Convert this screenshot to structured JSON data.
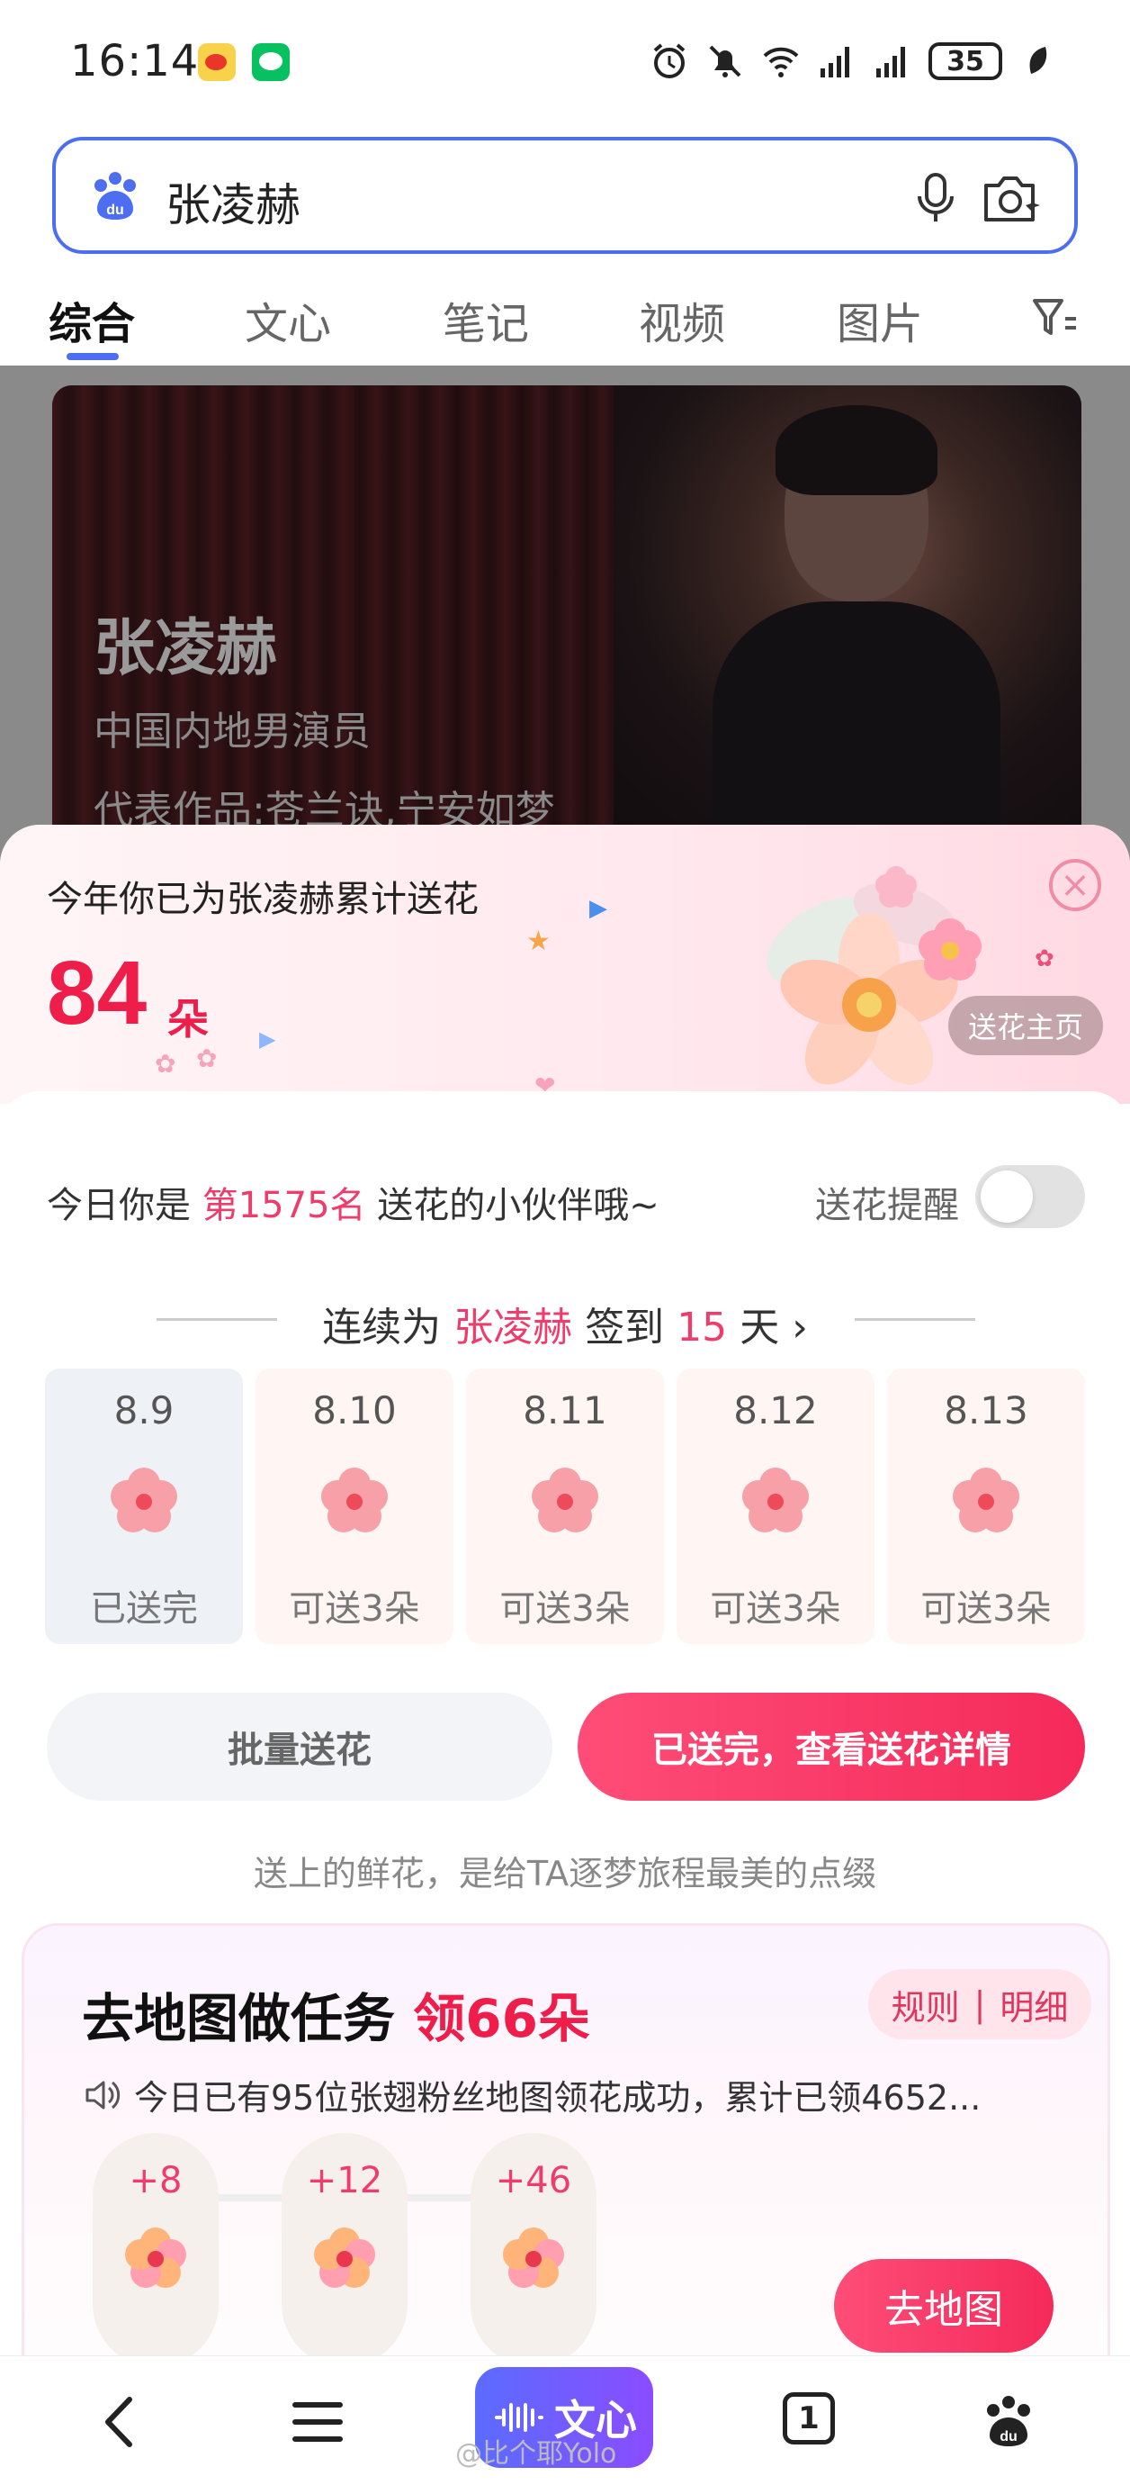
{
  "status_bar": {
    "time": "16:14",
    "battery": "35",
    "icons": [
      "weibo-icon",
      "wechat-icon",
      "alarm-icon",
      "mute-icon",
      "wifi-icon",
      "signal-icon",
      "signal-icon",
      "battery-icon",
      "leaf-icon"
    ]
  },
  "search": {
    "query": "张凌赫",
    "icons": [
      "baidu-logo",
      "microphone-icon",
      "camera-search-icon"
    ]
  },
  "tabs": [
    {
      "label": "综合",
      "active": true
    },
    {
      "label": "文心",
      "active": false
    },
    {
      "label": "笔记",
      "active": false
    },
    {
      "label": "视频",
      "active": false
    },
    {
      "label": "图片",
      "active": false
    }
  ],
  "hero": {
    "name": "张凌赫",
    "subtitle": "中国内地男演员",
    "works": "代表作品:苍兰诀,宁安如梦"
  },
  "gift_panel": {
    "title": "今年你已为张凌赫累计送花",
    "count": "84",
    "unit": "朵",
    "home_button": "送花主页",
    "rank_prefix": "今日你是",
    "rank_value": "第1575名",
    "rank_suffix": "送花的小伙伴哦~",
    "remind_label": "送花提醒",
    "remind_on": false,
    "streak_prefix": "连续为",
    "streak_name": "张凌赫",
    "streak_mid": "签到",
    "streak_days": "15",
    "streak_unit": "天",
    "days": [
      {
        "date": "8.9",
        "status": "已送完",
        "done": true
      },
      {
        "date": "8.10",
        "status": "可送3朵",
        "done": false
      },
      {
        "date": "8.11",
        "status": "可送3朵",
        "done": false
      },
      {
        "date": "8.12",
        "status": "可送3朵",
        "done": false
      },
      {
        "date": "8.13",
        "status": "可送3朵",
        "done": false
      }
    ],
    "batch_button": "批量送花",
    "sent_button": "已送完，查看送花详情",
    "slogan": "送上的鲜花，是给TA逐梦旅程最美的点缀"
  },
  "task_card": {
    "title_prefix": "去地图做任务",
    "title_highlight": "领66朵",
    "rules_label": "规则",
    "details_label": "明细",
    "notice": "今日已有95位张翅粉丝地图领花成功，累计已领4652...",
    "rewards": [
      "+8",
      "+12",
      "+46"
    ],
    "map_button": "去地图"
  },
  "bottom_nav": {
    "wenxin_label": "文心",
    "tab_count": "1",
    "icons": [
      "back-icon",
      "menu-icon",
      "wenxin-icon",
      "tabs-icon",
      "baidu-home-icon"
    ]
  },
  "watermark": "@比个耶Yolo",
  "colors": {
    "accent_blue": "#4e6ef2",
    "accent_red": "#ee1d4a",
    "pink": "#ee3d6c"
  }
}
